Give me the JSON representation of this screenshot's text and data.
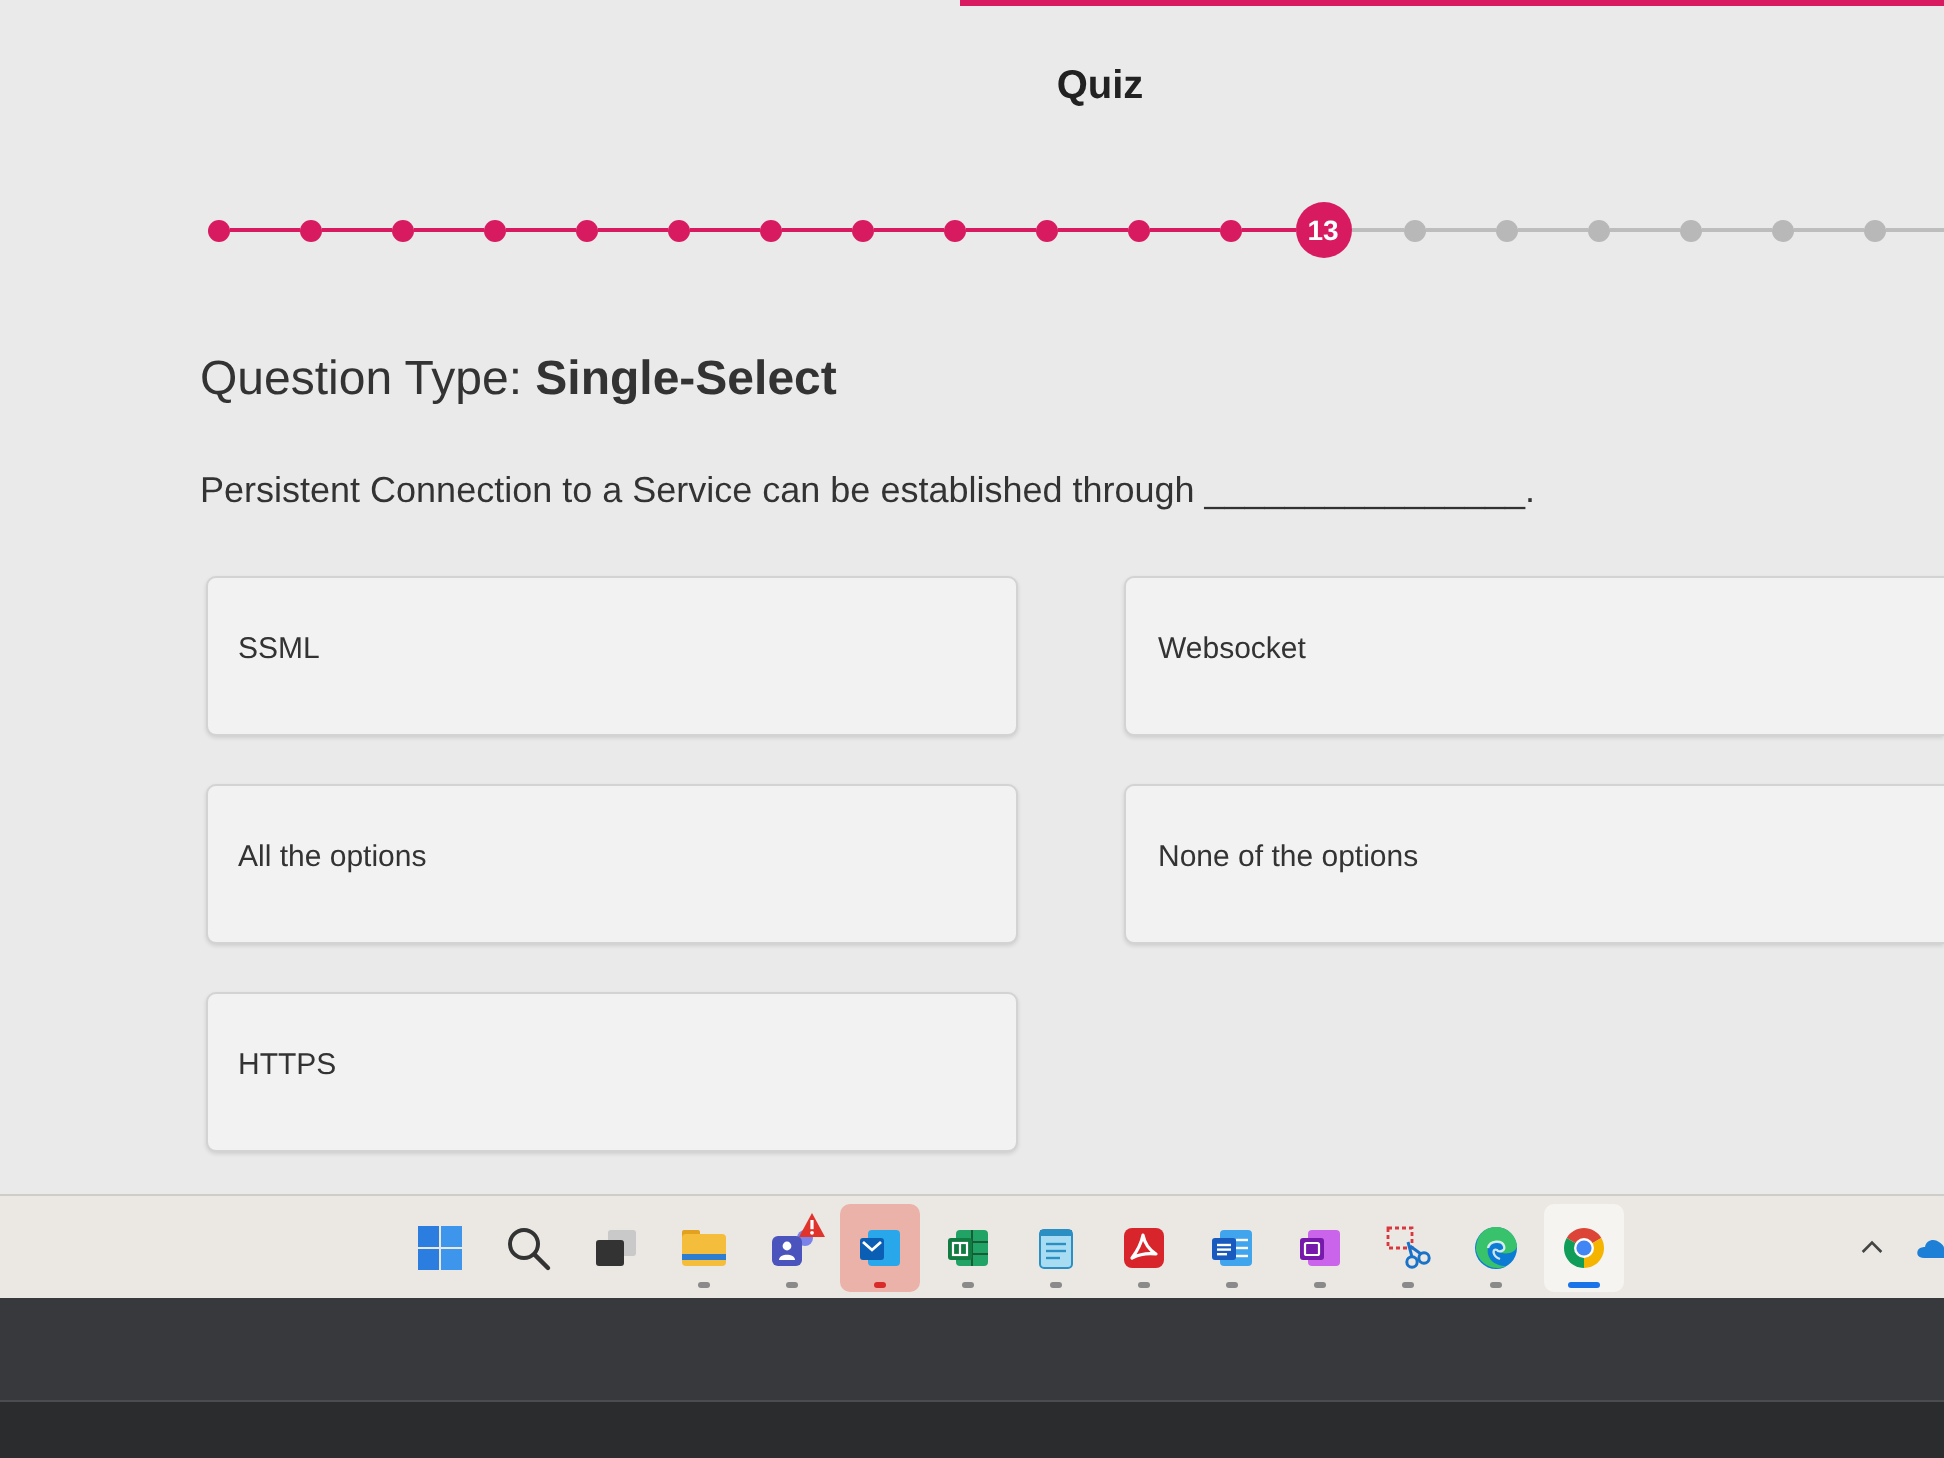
{
  "header": {
    "title": "Quiz"
  },
  "progress": {
    "steps": [
      {
        "kind": "done"
      },
      {
        "kind": "done"
      },
      {
        "kind": "done"
      },
      {
        "kind": "done"
      },
      {
        "kind": "done"
      },
      {
        "kind": "done"
      },
      {
        "kind": "done"
      },
      {
        "kind": "done"
      },
      {
        "kind": "done"
      },
      {
        "kind": "done"
      },
      {
        "kind": "done"
      },
      {
        "kind": "done"
      },
      {
        "kind": "current",
        "label": "13"
      },
      {
        "kind": "upcoming"
      },
      {
        "kind": "upcoming"
      },
      {
        "kind": "upcoming"
      },
      {
        "kind": "upcoming"
      },
      {
        "kind": "upcoming"
      },
      {
        "kind": "upcoming"
      }
    ]
  },
  "question": {
    "type_line": "Question Type: **Single-Select**",
    "prompt": "Persistent Connection to a Service can be established through ________________."
  },
  "options": [
    {
      "label": "SSML",
      "selected": false
    },
    {
      "label": "Websocket",
      "selected": false
    },
    {
      "label": "All the options",
      "selected": false
    },
    {
      "label": "None of the options",
      "selected": false
    },
    {
      "label": "HTTPS",
      "selected": false
    }
  ],
  "taskbar": {
    "apps": [
      {
        "kind": "squares",
        "running": false,
        "focused": false,
        "attention": false,
        "alert": false
      },
      {
        "kind": "search",
        "running": false,
        "focused": false,
        "attention": false,
        "alert": false
      },
      {
        "kind": "taskview",
        "running": false,
        "focused": false,
        "attention": false,
        "alert": false
      },
      {
        "kind": "folder",
        "running": true,
        "focused": false,
        "attention": false,
        "alert": false
      },
      {
        "kind": "people",
        "running": true,
        "focused": false,
        "attention": false,
        "alert": true
      },
      {
        "kind": "mail",
        "running": true,
        "focused": false,
        "attention": true,
        "alert": false
      },
      {
        "kind": "sheet",
        "running": true,
        "focused": false,
        "attention": false,
        "alert": false
      },
      {
        "kind": "notepad",
        "running": true,
        "focused": false,
        "attention": false,
        "alert": false
      },
      {
        "kind": "swirl",
        "running": true,
        "focused": false,
        "attention": false,
        "alert": false
      },
      {
        "kind": "doc",
        "running": true,
        "focused": false,
        "attention": false,
        "alert": false
      },
      {
        "kind": "notebook",
        "running": true,
        "focused": false,
        "attention": false,
        "alert": false
      },
      {
        "kind": "scissors",
        "running": true,
        "focused": false,
        "attention": false,
        "alert": false
      },
      {
        "kind": "wave",
        "running": true,
        "focused": false,
        "attention": false,
        "alert": false
      },
      {
        "kind": "wheel",
        "running": true,
        "focused": true,
        "attention": false,
        "alert": false
      }
    ]
  }
}
